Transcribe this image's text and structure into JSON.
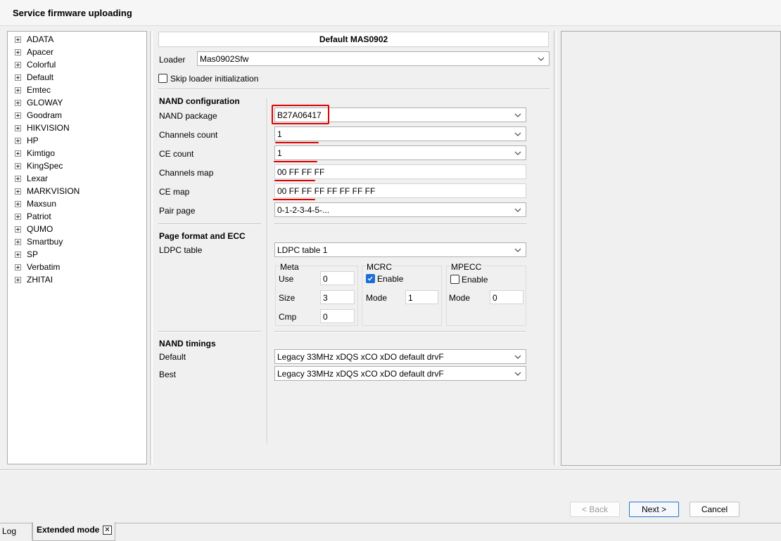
{
  "window": {
    "title": "Service firmware uploading"
  },
  "vendors": [
    "ADATA",
    "Apacer",
    "Colorful",
    "Default",
    "Emtec",
    "GLOWAY",
    "Goodram",
    "HIKVISION",
    "HP",
    "Kimtigo",
    "KingSpec",
    "Lexar",
    "MARKVISION",
    "Maxsun",
    "Patriot",
    "QUMO",
    "Smartbuy",
    "SP",
    "Verbatim",
    "ZHITAI"
  ],
  "config": {
    "header": "Default MAS0902",
    "loader_label": "Loader",
    "loader_value": "Mas0902Sfw",
    "skip_loader_label": "Skip loader initialization",
    "skip_loader_checked": false
  },
  "nand": {
    "section": "NAND configuration",
    "package_label": "NAND package",
    "package_value": "B27A06417",
    "channels_count_label": "Channels count",
    "channels_count_value": "1",
    "ce_count_label": "CE count",
    "ce_count_value": "1",
    "channels_map_label": "Channels map",
    "channels_map_value": "00 FF FF FF",
    "ce_map_label": "CE map",
    "ce_map_value": "00 FF FF FF FF FF FF FF",
    "pair_page_label": "Pair page",
    "pair_page_value": "0-1-2-3-4-5-..."
  },
  "page_format": {
    "section": "Page format and ECC",
    "ldpc_label": "LDPC table",
    "ldpc_value": "LDPC table 1",
    "meta": {
      "title": "Meta",
      "use_label": "Use",
      "use_value": "0",
      "size_label": "Size",
      "size_value": "3",
      "cmp_label": "Cmp",
      "cmp_value": "0"
    },
    "mcrc": {
      "title": "MCRC",
      "enable_label": "Enable",
      "enable_checked": true,
      "mode_label": "Mode",
      "mode_value": "1"
    },
    "mpecc": {
      "title": "MPECC",
      "enable_label": "Enable",
      "enable_checked": false,
      "mode_label": "Mode",
      "mode_value": "0"
    }
  },
  "timings": {
    "section": "NAND timings",
    "default_label": "Default",
    "default_value": "Legacy 33MHz xDQS xCO xDO default drvF",
    "best_label": "Best",
    "best_value": "Legacy 33MHz xDQS xCO xDO default drvF"
  },
  "buttons": {
    "back": "< Back",
    "next": "Next >",
    "cancel": "Cancel"
  },
  "tabs": {
    "log": "Log",
    "extended": "Extended mode",
    "close_glyph": "✕"
  },
  "annotation_color": "#e00000"
}
